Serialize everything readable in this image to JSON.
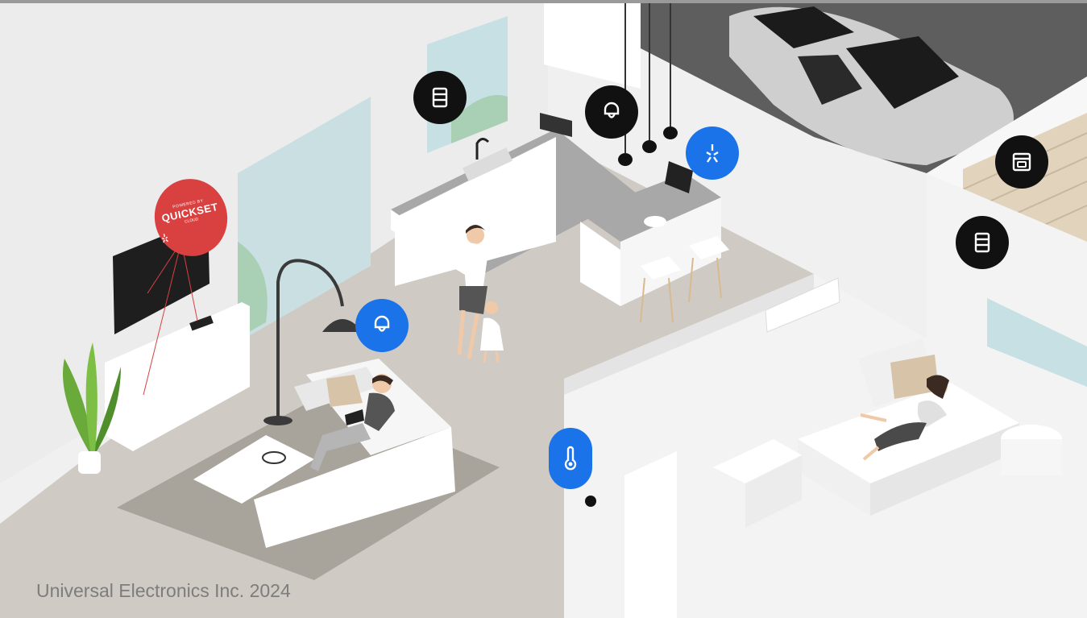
{
  "copyright": "Universal Electronics Inc. 2024",
  "quickset_badge": {
    "powered_by": "POWERED BY",
    "logo": "QUICKSET",
    "sub": "CLOUD",
    "color": "#d94040"
  },
  "colors": {
    "badge_dark": "#111111",
    "badge_blue": "#1a73e8",
    "floor": "#cfcac3",
    "walls": "#f2f2f2"
  },
  "device_badges": [
    {
      "id": "kitchen-blinds",
      "icon": "blinds-icon",
      "style": "dark"
    },
    {
      "id": "kitchen-light",
      "icon": "lightbulb-icon",
      "style": "dark"
    },
    {
      "id": "kitchen-hub",
      "icon": "hub-icon",
      "style": "blue"
    },
    {
      "id": "living-light",
      "icon": "lightbulb-icon",
      "style": "blue"
    },
    {
      "id": "thermostat",
      "icon": "thermometer-icon",
      "style": "blue"
    },
    {
      "id": "garage-door",
      "icon": "garage-door-icon",
      "style": "dark"
    },
    {
      "id": "bedroom-blinds",
      "icon": "blinds-icon",
      "style": "dark"
    }
  ]
}
